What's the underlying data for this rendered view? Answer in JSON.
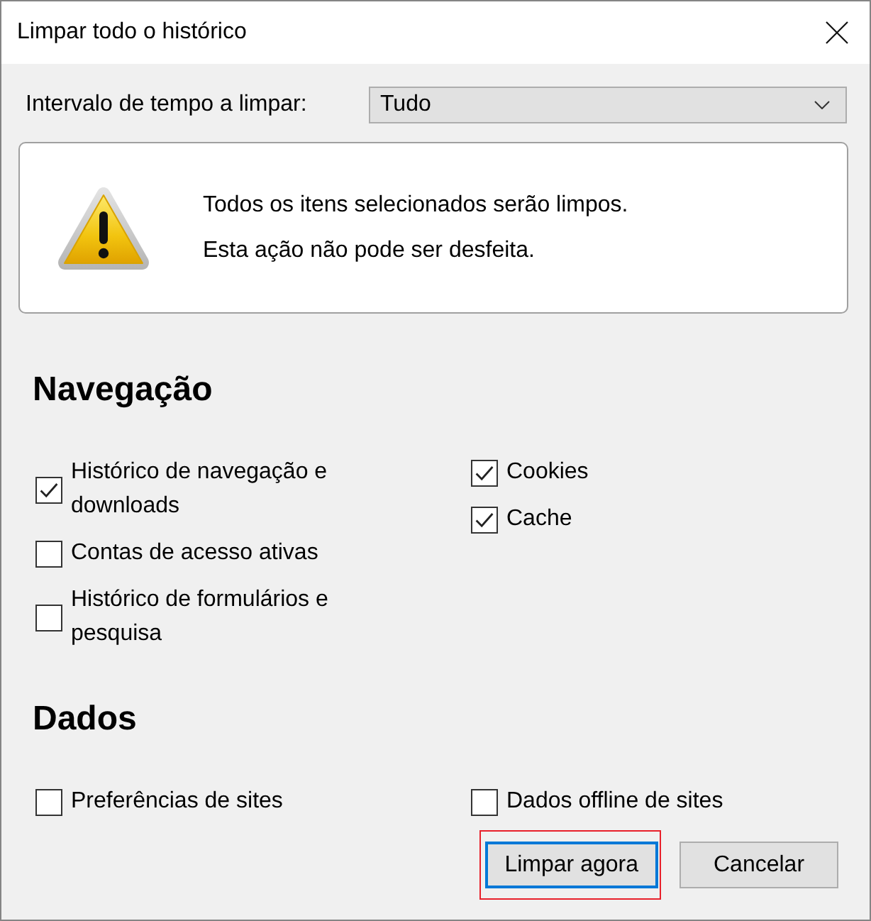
{
  "window": {
    "title": "Limpar todo o histórico"
  },
  "time_range": {
    "label": "Intervalo de tempo a limpar:",
    "value": "Tudo"
  },
  "warning": {
    "lines": [
      "Todos os itens selecionados serão limpos.",
      "Esta ação não pode ser desfeita."
    ]
  },
  "sections": [
    {
      "heading": "Navegação",
      "columns": [
        [
          {
            "label": "Histórico de navegação e downloads",
            "checked": true
          },
          {
            "label": "Contas de acesso ativas",
            "checked": false
          },
          {
            "label": "Histórico de formulários e pesquisa",
            "checked": false
          }
        ],
        [
          {
            "label": "Cookies",
            "checked": true
          },
          {
            "label": "Cache",
            "checked": true
          }
        ]
      ]
    },
    {
      "heading": "Dados",
      "columns": [
        [
          {
            "label": "Preferências de sites",
            "checked": false
          }
        ],
        [
          {
            "label": "Dados offline de sites",
            "checked": false
          }
        ]
      ]
    }
  ],
  "buttons": [
    {
      "label": "Limpar agora",
      "default": true,
      "highlighted": true
    },
    {
      "label": "Cancelar",
      "default": false,
      "highlighted": false
    }
  ]
}
